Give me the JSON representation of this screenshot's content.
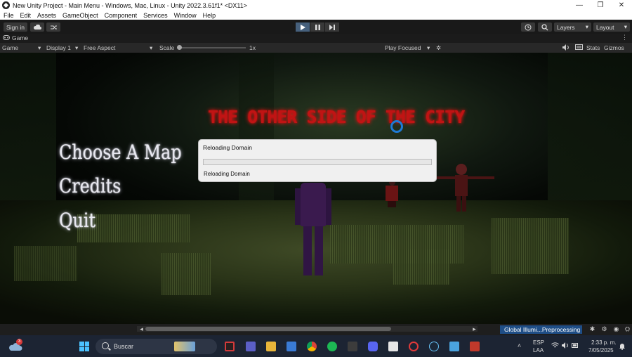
{
  "window": {
    "title": "New Unity Project - Main Menu - Windows, Mac, Linux - Unity 2022.3.61f1* <DX11>",
    "controls": [
      "—",
      "❐",
      "✕"
    ]
  },
  "menu": [
    "File",
    "Edit",
    "Assets",
    "GameObject",
    "Component",
    "Services",
    "Window",
    "Help"
  ],
  "toolbar": {
    "sign_in": "Sign in",
    "layers": "Layers",
    "layout": "Layout"
  },
  "game_tab": {
    "label": "Game"
  },
  "game_bar": {
    "view": "Game",
    "display": "Display 1",
    "aspect": "Free Aspect",
    "scale_label": "Scale",
    "scale_value": "1x",
    "play_mode": "Play Focused",
    "stats": "Stats",
    "gizmos": "Gizmos"
  },
  "game": {
    "title": "THE OTHER SIDE OF THE CITY",
    "menu_options": [
      "Choose A Map",
      "Credits",
      "Quit"
    ]
  },
  "dialog": {
    "title": "Reloading Domain",
    "message": "Reloading Domain",
    "progress": 0
  },
  "status": {
    "progress_label": "Global Illumi...Preprocessing"
  },
  "taskbar": {
    "weather_badge": "3",
    "search_placeholder": "Buscar",
    "language": "ESP",
    "layout": "LAA",
    "time": "2:33 p. m.",
    "date": "7/05/2025"
  },
  "colors": {
    "unity_dark": "#1e1e1e",
    "game_title_red": "#c01414",
    "progress_blue": "#1f4e87",
    "taskbar": "#1c2433"
  }
}
